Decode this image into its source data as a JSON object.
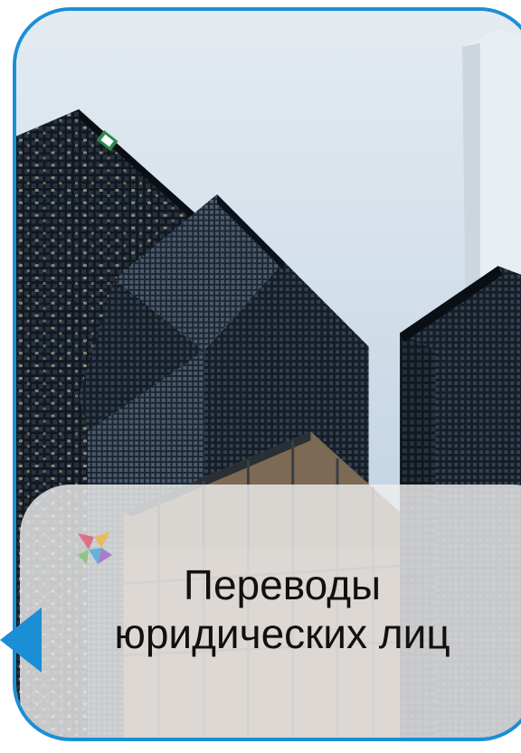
{
  "caption": {
    "line1": "Переводы",
    "line2": "юридических лиц"
  },
  "colors": {
    "accent_border": "#1b8fd6",
    "sky": "#cfdde9",
    "panel": "#eeeeee",
    "text": "#111111"
  },
  "icons": {
    "pointer": "triangle-left-icon",
    "logo": "colorful-star-logo-icon"
  }
}
